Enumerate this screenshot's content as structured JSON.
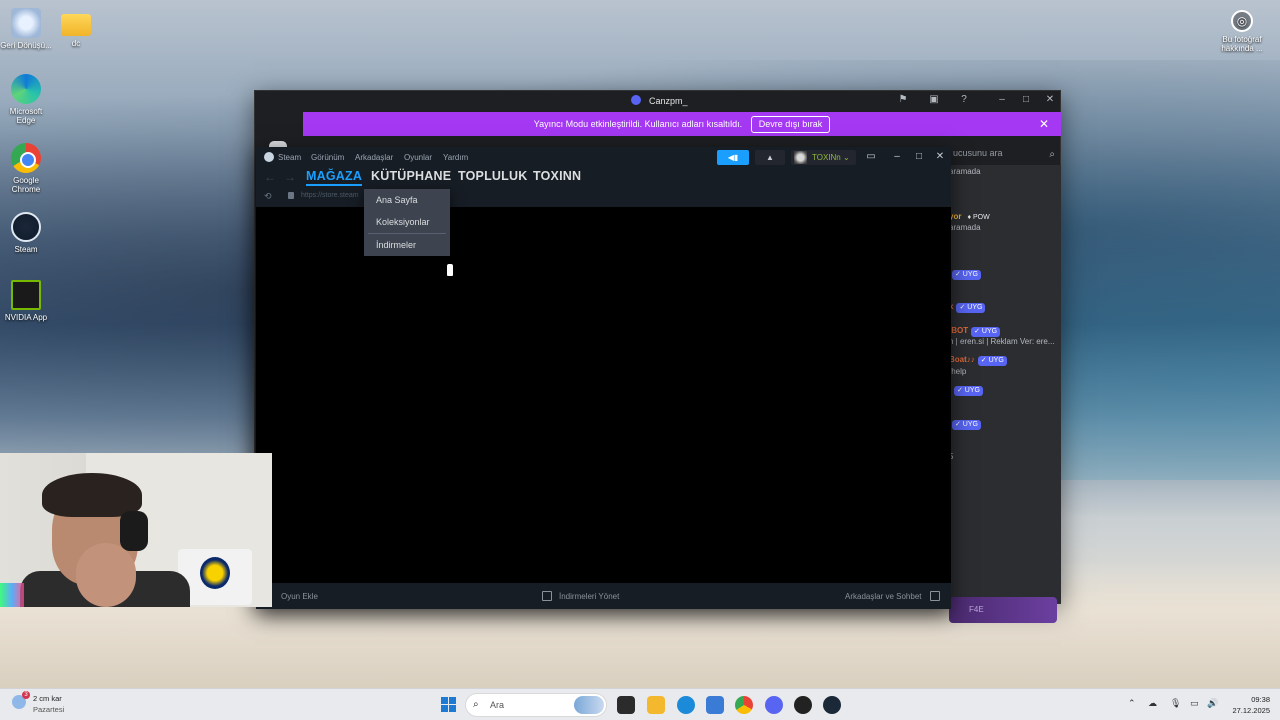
{
  "desktop": {
    "icons": [
      {
        "label": "Geri Dönüşü...",
        "icon": "recycle-bin-icon"
      },
      {
        "label": "dc",
        "icon": "folder-icon"
      },
      {
        "label": "Microsoft Edge",
        "icon": "edge-icon"
      },
      {
        "label": "Google Chrome",
        "icon": "chrome-icon"
      },
      {
        "label": "Steam",
        "icon": "steam-icon"
      },
      {
        "label": "NVIDIA App",
        "icon": "nvidia-icon"
      }
    ],
    "photo_info": "Bu fotoğraf hakkında ..."
  },
  "discord": {
    "title": "Canzpm_",
    "banner_text": "Yayıncı Modu etkinleştirildi. Kullanıcı adları kısaltıldı.",
    "banner_button": "Devre dışı bırak",
    "search_placeholder": "ucusunu ara",
    "members": [
      {
        "name": "",
        "sub": "aramada",
        "tag": ""
      },
      {
        "name": "yor",
        "sub": "aramada",
        "tag": "POW"
      },
      {
        "name": "",
        "sub": "",
        "tag": "✓ UYG"
      },
      {
        "name": "x",
        "sub": "",
        "tag": "✓ UYG"
      },
      {
        "name": "IBOT",
        "sub": "n | eren.si | Reklam Ver: ere...",
        "tag": "✓ UYG"
      },
      {
        "name": "Boat♪♪",
        "sub": "/help",
        "tag": "✓ UYG"
      },
      {
        "name": "",
        "sub": "",
        "tag": "✓ UYG"
      },
      {
        "name": "",
        "sub": "",
        "tag": "✓ UYG"
      },
      {
        "name": "5",
        "sub": "",
        "tag": ""
      }
    ],
    "boost_label": "F4E",
    "colors": {
      "banner": "#a438f3",
      "tag": "#5865f2"
    }
  },
  "steam": {
    "menu": [
      "Steam",
      "Görünüm",
      "Arkadaşlar",
      "Oyunlar",
      "Yardım"
    ],
    "username": "TOXINn",
    "tabs": [
      "MAĞAZA",
      "KÜTÜPHANE",
      "TOPLULUK",
      "TOXINN"
    ],
    "active_tab": "MAĞAZA",
    "url": "https://store.steam",
    "dropdown": [
      "Ana Sayfa",
      "Koleksiyonlar",
      "İndirmeler"
    ],
    "bottom": {
      "add_game": "Oyun Ekle",
      "downloads": "İndirmeleri Yönet",
      "friends": "Arkadaşlar ve Sohbet"
    },
    "colors": {
      "accent": "#1a9fff",
      "bg": "#171d25"
    }
  },
  "taskbar": {
    "weather_main": "2 cm kar",
    "weather_sub": "Pazartesi",
    "weather_badge": "3",
    "search_placeholder": "Ara",
    "time": "09:38",
    "date": "27.12.2025",
    "pinned_apps": [
      "file-explorer-icon",
      "folder-icon",
      "edge-icon",
      "store-icon",
      "chrome-icon",
      "discord-icon",
      "app-icon",
      "steam-icon"
    ]
  }
}
